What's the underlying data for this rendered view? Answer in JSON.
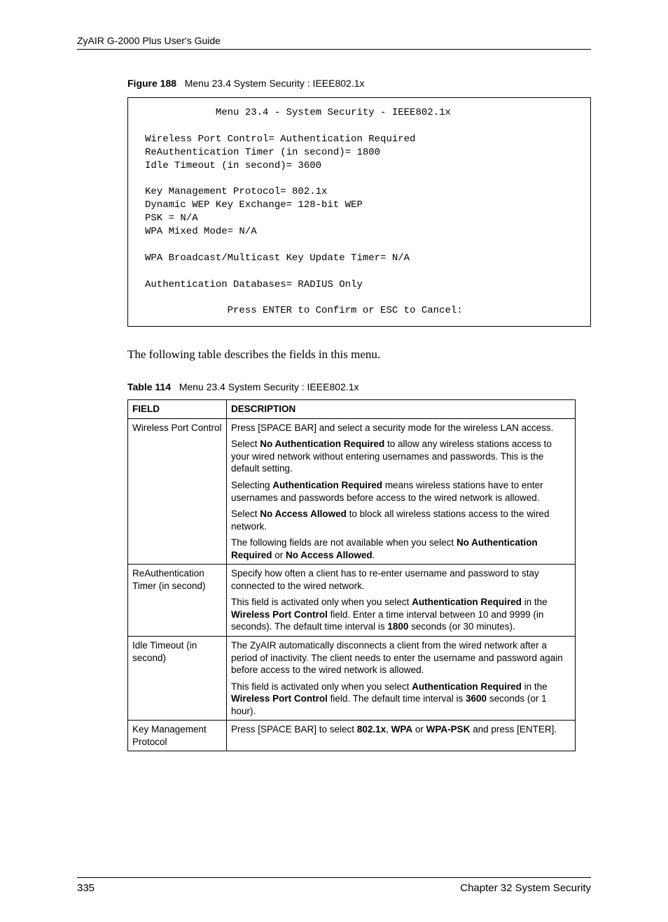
{
  "header": {
    "guide_title": "ZyAIR G-2000 Plus User's Guide"
  },
  "figure": {
    "label": "Figure 188",
    "caption": "Menu 23.4 System Security : IEEE802.1x",
    "terminal": "            Menu 23.4 - System Security - IEEE802.1x\n\nWireless Port Control= Authentication Required\nReAuthentication Timer (in second)= 1800\nIdle Timeout (in second)= 3600\n\nKey Management Protocol= 802.1x\nDynamic WEP Key Exchange= 128-bit WEP\nPSK = N/A\nWPA Mixed Mode= N/A\n\nWPA Broadcast/Multicast Key Update Timer= N/A\n\nAuthentication Databases= RADIUS Only\n\n              Press ENTER to Confirm or ESC to Cancel:"
  },
  "intro": "The following table describes the fields in this menu.",
  "table": {
    "label": "Table 114",
    "caption": "Menu 23.4 System Security : IEEE802.1x",
    "head_field": "FIELD",
    "head_desc": "DESCRIPTION",
    "rows": [
      {
        "field": "Wireless Port Control",
        "desc_html": "<p>Press [SPACE BAR] and select a security mode for the wireless LAN access.</p><p>Select <strong>No Authentication Required</strong> to allow any wireless stations access to your wired network without entering usernames and passwords. This is the default setting.</p><p>Selecting <strong>Authentication Required</strong> means wireless stations have to enter usernames and passwords before access to the wired network is allowed.</p><p>Select <strong>No Access Allowed</strong> to block all wireless stations access to the wired network.</p><p>The following fields are not available when you select <strong>No Authentication Required</strong> or <strong>No Access Allowed</strong>.</p>"
      },
      {
        "field": "ReAuthentication Timer (in second)",
        "desc_html": "<p>Specify how often a client has to re-enter username and password to stay connected to the wired network.</p><p>This field is activated only when you select <strong>Authentication Required</strong> in the <strong>Wireless Port Control</strong> field. Enter a time interval between 10 and 9999 (in seconds). The default time interval is <strong>1800</strong> seconds (or 30 minutes).</p>"
      },
      {
        "field": "Idle Timeout (in second)",
        "desc_html": "<p>The ZyAIR automatically disconnects a client from the wired network after a period of inactivity. The client needs to enter the username and password again before access to the wired network is allowed.</p><p>This field is activated only when you select <strong>Authentication Required</strong> in the <strong>Wireless Port Control</strong> field. The default time interval is <strong>3600</strong> seconds (or 1 hour).</p>"
      },
      {
        "field": "Key Management Protocol",
        "desc_html": "<p>Press [SPACE BAR] to select <strong>802.1x</strong>, <strong>WPA</strong> or <strong>WPA-PSK</strong> and press [ENTER].</p>"
      }
    ]
  },
  "footer": {
    "page_number": "335",
    "chapter": "Chapter 32 System Security"
  }
}
